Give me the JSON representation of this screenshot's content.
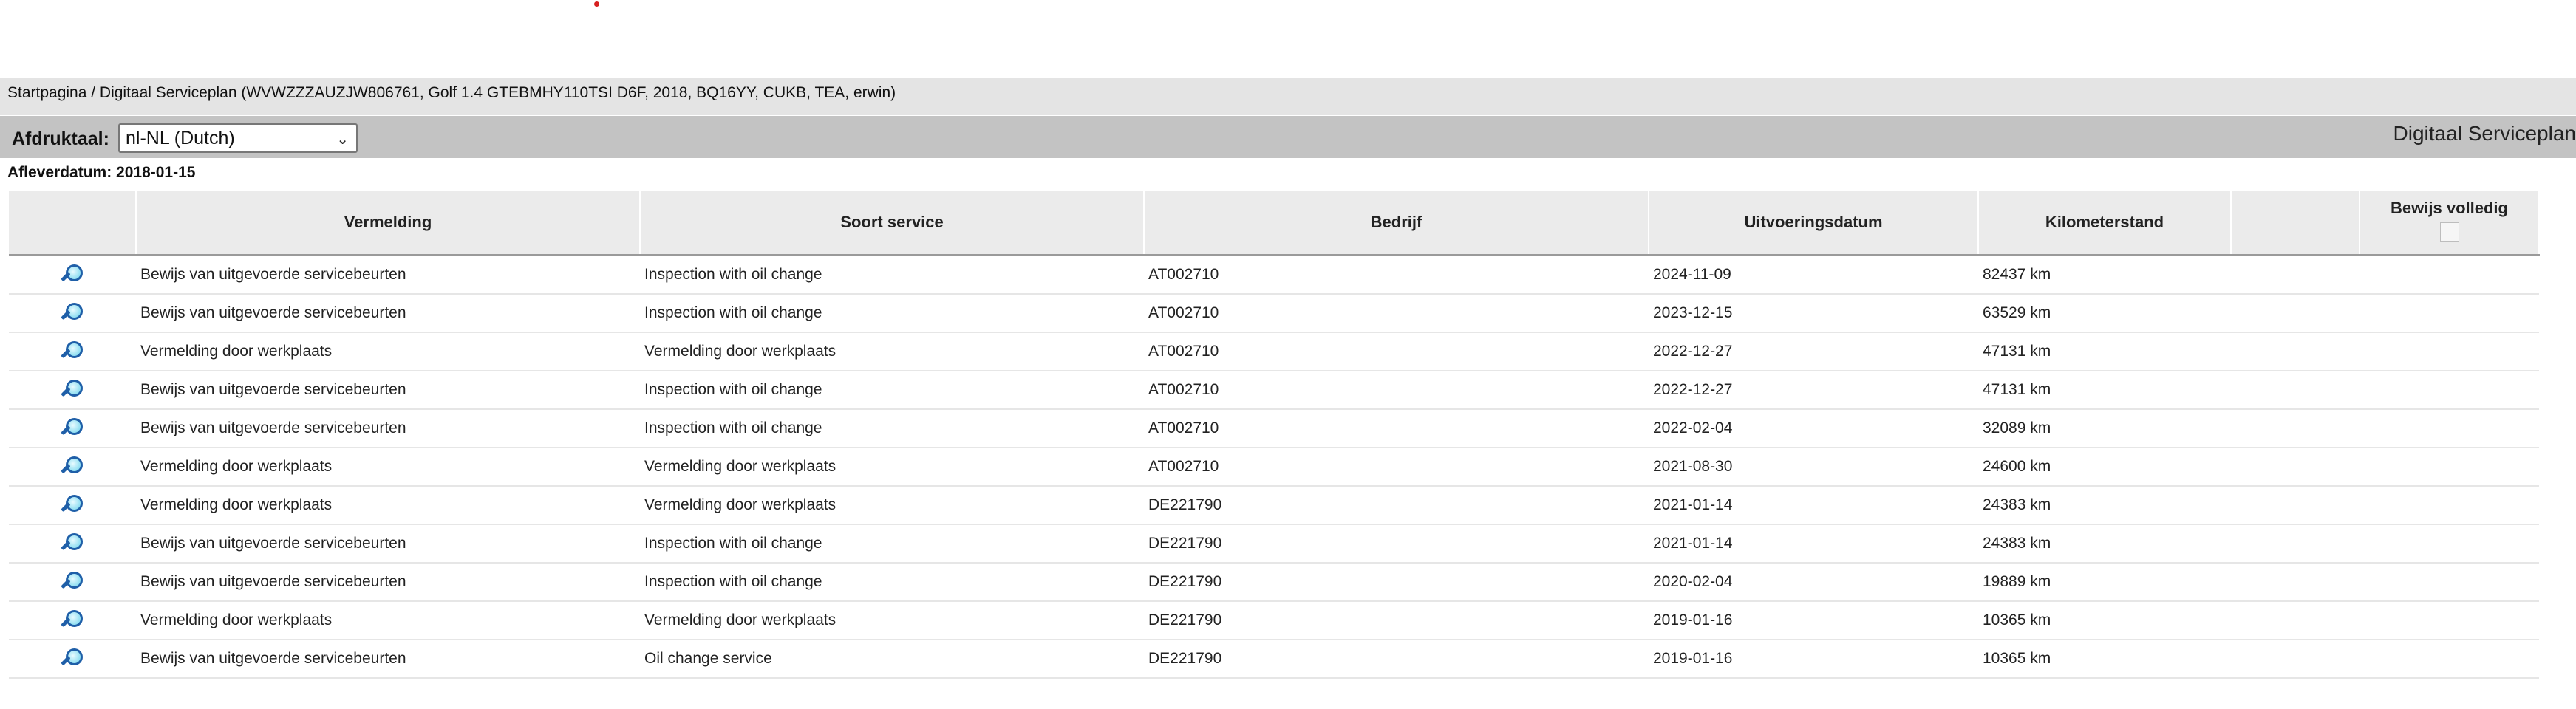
{
  "breadcrumb": {
    "text": "Startpagina / Digitaal Serviceplan (WVWZZZAUZJW806761, Golf 1.4 GTEBMHY110TSI D6F, 2018, BQ16YY, CUKB, TEA, erwin)"
  },
  "language": {
    "label": "Afdruktaal:",
    "selected": "nl-NL (Dutch)"
  },
  "brand_title": "Digitaal Serviceplan",
  "delivery_date": "Afleverdatum: 2018-01-15",
  "table": {
    "headers": [
      "",
      "Vermelding",
      "Soort service",
      "Bedrijf",
      "Uitvoeringsdatum",
      "Kilometerstand",
      "",
      "Bewijs volledig"
    ],
    "rows": [
      {
        "vermelding": "Bewijs van uitgevoerde servicebeurten",
        "soort": "Inspection with oil change",
        "bedrijf": "AT002710",
        "datum": "2024-11-09",
        "km": "82437 km"
      },
      {
        "vermelding": "Bewijs van uitgevoerde servicebeurten",
        "soort": "Inspection with oil change",
        "bedrijf": "AT002710",
        "datum": "2023-12-15",
        "km": "63529 km"
      },
      {
        "vermelding": "Vermelding door werkplaats",
        "soort": "Vermelding door werkplaats",
        "bedrijf": "AT002710",
        "datum": "2022-12-27",
        "km": "47131 km"
      },
      {
        "vermelding": "Bewijs van uitgevoerde servicebeurten",
        "soort": "Inspection with oil change",
        "bedrijf": "AT002710",
        "datum": "2022-12-27",
        "km": "47131 km"
      },
      {
        "vermelding": "Bewijs van uitgevoerde servicebeurten",
        "soort": "Inspection with oil change",
        "bedrijf": "AT002710",
        "datum": "2022-02-04",
        "km": "32089 km"
      },
      {
        "vermelding": "Vermelding door werkplaats",
        "soort": "Vermelding door werkplaats",
        "bedrijf": "AT002710",
        "datum": "2021-08-30",
        "km": "24600 km"
      },
      {
        "vermelding": "Vermelding door werkplaats",
        "soort": "Vermelding door werkplaats",
        "bedrijf": "DE221790",
        "datum": "2021-01-14",
        "km": "24383 km"
      },
      {
        "vermelding": "Bewijs van uitgevoerde servicebeurten",
        "soort": "Inspection with oil change",
        "bedrijf": "DE221790",
        "datum": "2021-01-14",
        "km": "24383 km"
      },
      {
        "vermelding": "Bewijs van uitgevoerde servicebeurten",
        "soort": "Inspection with oil change",
        "bedrijf": "DE221790",
        "datum": "2020-02-04",
        "km": "19889 km"
      },
      {
        "vermelding": "Vermelding door werkplaats",
        "soort": "Vermelding door werkplaats",
        "bedrijf": "DE221790",
        "datum": "2019-01-16",
        "km": "10365 km"
      },
      {
        "vermelding": "Bewijs van uitgevoerde servicebeurten",
        "soort": "Oil change service",
        "bedrijf": "DE221790",
        "datum": "2019-01-16",
        "km": "10365 km"
      }
    ]
  },
  "icons": {
    "row_view": "magnifier-icon",
    "language_dropdown": "chevron-down-icon"
  },
  "colors": {
    "breadcrumb_bg": "#e4e4e4",
    "toolbar_bg": "#c3c3c3",
    "header_bg": "#ebebeb",
    "magnifier": "#1f5fa8",
    "marker": "#d62020"
  }
}
